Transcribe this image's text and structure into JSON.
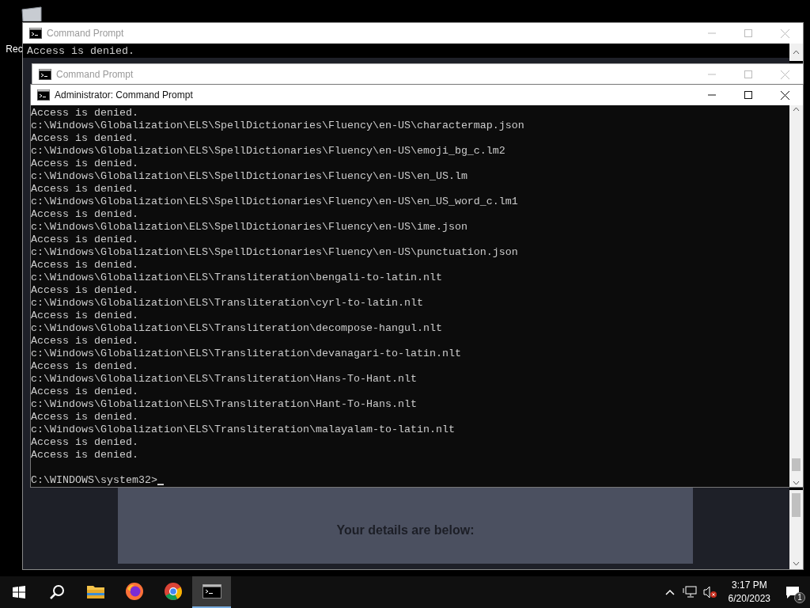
{
  "desktop_icons": [
    {
      "label": "Rec"
    }
  ],
  "back_window": {
    "title": "Command Prompt",
    "lines": [
      "Access is denied."
    ]
  },
  "middle_window": {
    "title": "Command Prompt"
  },
  "browser_behind": {
    "heading": "Your details are below:"
  },
  "main_window": {
    "title": "Administrator:  Command Prompt",
    "lines": [
      "Access is denied.",
      "c:\\Windows\\Globalization\\ELS\\SpellDictionaries\\Fluency\\en-US\\charactermap.json",
      "Access is denied.",
      "c:\\Windows\\Globalization\\ELS\\SpellDictionaries\\Fluency\\en-US\\emoji_bg_c.lm2",
      "Access is denied.",
      "c:\\Windows\\Globalization\\ELS\\SpellDictionaries\\Fluency\\en-US\\en_US.lm",
      "Access is denied.",
      "c:\\Windows\\Globalization\\ELS\\SpellDictionaries\\Fluency\\en-US\\en_US_word_c.lm1",
      "Access is denied.",
      "c:\\Windows\\Globalization\\ELS\\SpellDictionaries\\Fluency\\en-US\\ime.json",
      "Access is denied.",
      "c:\\Windows\\Globalization\\ELS\\SpellDictionaries\\Fluency\\en-US\\punctuation.json",
      "Access is denied.",
      "c:\\Windows\\Globalization\\ELS\\Transliteration\\bengali-to-latin.nlt",
      "Access is denied.",
      "c:\\Windows\\Globalization\\ELS\\Transliteration\\cyrl-to-latin.nlt",
      "Access is denied.",
      "c:\\Windows\\Globalization\\ELS\\Transliteration\\decompose-hangul.nlt",
      "Access is denied.",
      "c:\\Windows\\Globalization\\ELS\\Transliteration\\devanagari-to-latin.nlt",
      "Access is denied.",
      "c:\\Windows\\Globalization\\ELS\\Transliteration\\Hans-To-Hant.nlt",
      "Access is denied.",
      "c:\\Windows\\Globalization\\ELS\\Transliteration\\Hant-To-Hans.nlt",
      "Access is denied.",
      "c:\\Windows\\Globalization\\ELS\\Transliteration\\malayalam-to-latin.nlt",
      "Access is denied.",
      "Access is denied."
    ],
    "prompt": "C:\\WINDOWS\\system32>"
  },
  "taskbar": {
    "apps": [
      {
        "kind": "explorer",
        "selected": false
      },
      {
        "kind": "firefox",
        "selected": false
      },
      {
        "kind": "chrome",
        "selected": false
      },
      {
        "kind": "terminal",
        "selected": true
      }
    ],
    "time": "3:17 PM",
    "date": "6/20/2023",
    "notification_count": "1"
  }
}
